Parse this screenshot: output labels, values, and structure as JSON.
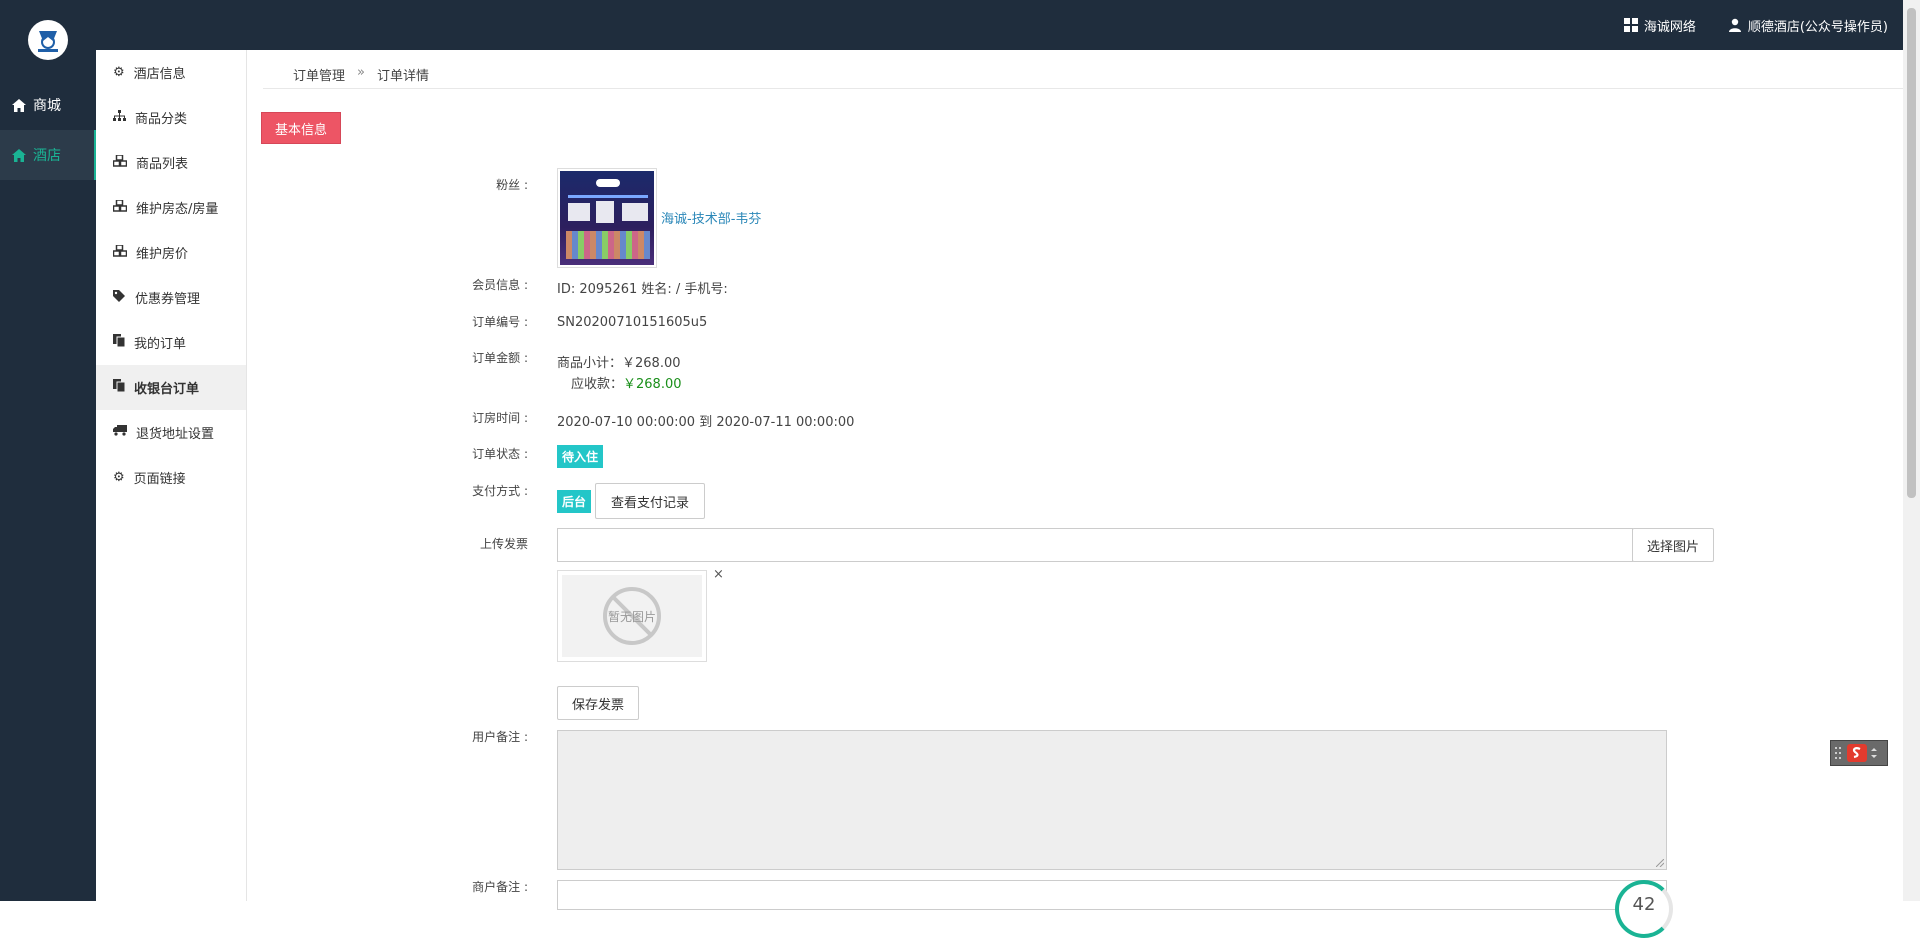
{
  "header": {
    "network_label": "海诚网络",
    "user_label": "顺德酒店(公众号操作员)"
  },
  "leftnav": {
    "items": [
      {
        "label": "商城"
      },
      {
        "label": "酒店"
      }
    ]
  },
  "submenu": {
    "items": [
      {
        "label": "酒店信息",
        "icon": "gears-icon"
      },
      {
        "label": "商品分类",
        "icon": "sitemap-icon"
      },
      {
        "label": "商品列表",
        "icon": "cubes-icon"
      },
      {
        "label": "维护房态/房量",
        "icon": "cubes-icon"
      },
      {
        "label": "维护房价",
        "icon": "cubes-icon"
      },
      {
        "label": "优惠券管理",
        "icon": "tags-icon"
      },
      {
        "label": "我的订单",
        "icon": "copy-icon"
      },
      {
        "label": "收银台订单",
        "icon": "copy-icon"
      },
      {
        "label": "退货地址设置",
        "icon": "truck-icon"
      },
      {
        "label": "页面链接",
        "icon": "gears-icon"
      }
    ]
  },
  "breadcrumb": {
    "parent": "订单管理",
    "separator": "»",
    "current": "订单详情"
  },
  "tab": {
    "label": "基本信息"
  },
  "form": {
    "fan_label": "粉丝 :",
    "fan_name": "海诚-技术部-韦芬",
    "member_label": "会员信息 :",
    "member_value": "ID: 2095261 姓名: / 手机号:",
    "order_no_label": "订单编号 :",
    "order_no_value": "SN20200710151605u5",
    "amount_label": "订单金额 :",
    "subtotal_label": "商品小计：",
    "subtotal_value": "￥268.00",
    "receivable_label": "应收款：",
    "receivable_value": "￥268.00",
    "time_label": "订房时间 :",
    "time_value": "2020-07-10 00:00:00 到 2020-07-11 00:00:00",
    "status_label": "订单状态 :",
    "status_value": "待入住",
    "payment_label": "支付方式 :",
    "payment_value": "后台",
    "payment_record_button": "查看支付记录",
    "invoice_label": "上传发票",
    "choose_image_button": "选择图片",
    "no_image_text": "暂无图片",
    "remove_mark": "×",
    "save_invoice_button": "保存发票",
    "user_note_label": "用户备注 :",
    "merchant_note_label": "商户备注 :"
  },
  "widget": {
    "counter": "42"
  },
  "colors": {
    "sidebar_bg": "#1f2d3d",
    "accent_green": "#1ab394",
    "tab_red": "#ed5565",
    "badge_cyan": "#23c6c8",
    "link_blue": "#2a87b8",
    "amount_green": "#1a8f1a"
  }
}
